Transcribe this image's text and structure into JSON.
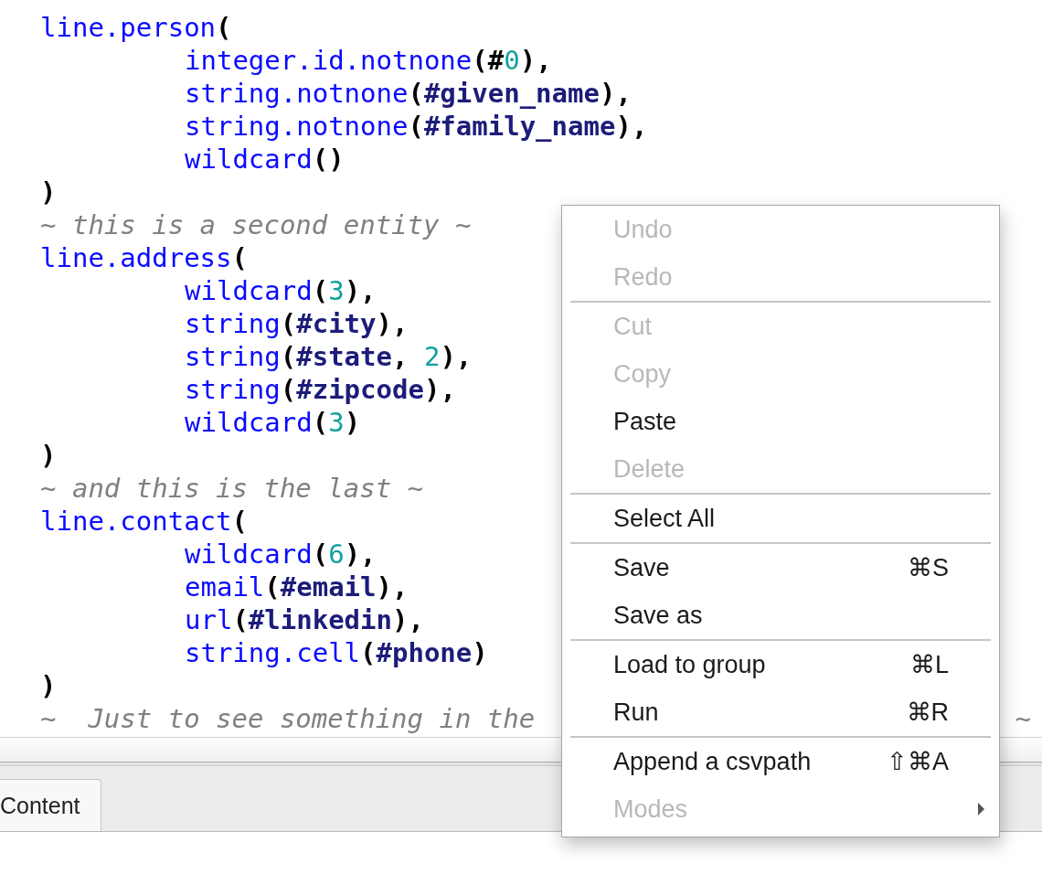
{
  "editor": {
    "lines": [
      {
        "tokens": [
          {
            "kind": "fn",
            "text": "line.person"
          },
          {
            "kind": "punct",
            "text": "("
          }
        ],
        "children": [
          {
            "tokens": [
              {
                "kind": "fn",
                "text": "integer.id.notnone"
              },
              {
                "kind": "punct",
                "text": "(#"
              },
              {
                "kind": "num",
                "text": "0"
              },
              {
                "kind": "punct",
                "text": "),"
              }
            ]
          },
          {
            "tokens": [
              {
                "kind": "fn",
                "text": "string.notnone"
              },
              {
                "kind": "punct",
                "text": "("
              },
              {
                "kind": "arg",
                "text": "#given_name"
              },
              {
                "kind": "punct",
                "text": "),"
              }
            ]
          },
          {
            "tokens": [
              {
                "kind": "fn",
                "text": "string.notnone"
              },
              {
                "kind": "punct",
                "text": "("
              },
              {
                "kind": "arg",
                "text": "#family_name"
              },
              {
                "kind": "punct",
                "text": "),"
              }
            ]
          },
          {
            "tokens": [
              {
                "kind": "fn",
                "text": "wildcard"
              },
              {
                "kind": "punct",
                "text": "()"
              }
            ]
          }
        ]
      },
      {
        "tokens": [
          {
            "kind": "punct",
            "text": ")"
          }
        ]
      },
      {
        "tokens": [
          {
            "kind": "comment",
            "text": "~ this is a second entity ~"
          }
        ]
      },
      {
        "tokens": [
          {
            "kind": "fn",
            "text": "line.address"
          },
          {
            "kind": "punct",
            "text": "("
          }
        ],
        "children": [
          {
            "tokens": [
              {
                "kind": "fn",
                "text": "wildcard"
              },
              {
                "kind": "punct",
                "text": "("
              },
              {
                "kind": "num",
                "text": "3"
              },
              {
                "kind": "punct",
                "text": "),"
              }
            ]
          },
          {
            "tokens": [
              {
                "kind": "fn",
                "text": "string"
              },
              {
                "kind": "punct",
                "text": "("
              },
              {
                "kind": "arg",
                "text": "#city"
              },
              {
                "kind": "punct",
                "text": "),"
              }
            ]
          },
          {
            "tokens": [
              {
                "kind": "fn",
                "text": "string"
              },
              {
                "kind": "punct",
                "text": "("
              },
              {
                "kind": "arg",
                "text": "#state"
              },
              {
                "kind": "punct",
                "text": ", "
              },
              {
                "kind": "num",
                "text": "2"
              },
              {
                "kind": "punct",
                "text": "),"
              }
            ]
          },
          {
            "tokens": [
              {
                "kind": "fn",
                "text": "string"
              },
              {
                "kind": "punct",
                "text": "("
              },
              {
                "kind": "arg",
                "text": "#zipcode"
              },
              {
                "kind": "punct",
                "text": "),"
              }
            ]
          },
          {
            "tokens": [
              {
                "kind": "fn",
                "text": "wildcard"
              },
              {
                "kind": "punct",
                "text": "("
              },
              {
                "kind": "num",
                "text": "3"
              },
              {
                "kind": "punct",
                "text": ")"
              }
            ]
          }
        ]
      },
      {
        "tokens": [
          {
            "kind": "punct",
            "text": ")"
          }
        ]
      },
      {
        "tokens": [
          {
            "kind": "comment",
            "text": "~ and this is the last ~"
          }
        ]
      },
      {
        "tokens": [
          {
            "kind": "fn",
            "text": "line.contact"
          },
          {
            "kind": "punct",
            "text": "("
          }
        ],
        "children": [
          {
            "tokens": [
              {
                "kind": "fn",
                "text": "wildcard"
              },
              {
                "kind": "punct",
                "text": "("
              },
              {
                "kind": "num",
                "text": "6"
              },
              {
                "kind": "punct",
                "text": "),"
              }
            ]
          },
          {
            "tokens": [
              {
                "kind": "fn",
                "text": "email"
              },
              {
                "kind": "punct",
                "text": "("
              },
              {
                "kind": "arg",
                "text": "#email"
              },
              {
                "kind": "punct",
                "text": "),"
              }
            ]
          },
          {
            "tokens": [
              {
                "kind": "fn",
                "text": "url"
              },
              {
                "kind": "punct",
                "text": "("
              },
              {
                "kind": "arg",
                "text": "#linkedin"
              },
              {
                "kind": "punct",
                "text": "),"
              }
            ]
          },
          {
            "tokens": [
              {
                "kind": "fn",
                "text": "string.cell"
              },
              {
                "kind": "punct",
                "text": "("
              },
              {
                "kind": "arg",
                "text": "#phone"
              },
              {
                "kind": "punct",
                "text": ")"
              }
            ]
          }
        ]
      },
      {
        "tokens": [
          {
            "kind": "punct",
            "text": ")"
          }
        ]
      },
      {
        "tokens": [
          {
            "kind": "comment",
            "text": "~  Just to see something in the"
          }
        ],
        "tail": "~"
      }
    ]
  },
  "tabs": [
    {
      "label": "Content",
      "selected": true
    }
  ],
  "context_menu": [
    {
      "kind": "item",
      "label": "Undo",
      "disabled": true
    },
    {
      "kind": "item",
      "label": "Redo",
      "disabled": true
    },
    {
      "kind": "separator"
    },
    {
      "kind": "item",
      "label": "Cut",
      "disabled": true
    },
    {
      "kind": "item",
      "label": "Copy",
      "disabled": true
    },
    {
      "kind": "item",
      "label": "Paste",
      "disabled": false
    },
    {
      "kind": "item",
      "label": "Delete",
      "disabled": true
    },
    {
      "kind": "separator"
    },
    {
      "kind": "item",
      "label": "Select All",
      "disabled": false
    },
    {
      "kind": "separator"
    },
    {
      "kind": "item",
      "label": "Save",
      "shortcut": "⌘S",
      "disabled": false
    },
    {
      "kind": "item",
      "label": "Save as",
      "disabled": false
    },
    {
      "kind": "separator"
    },
    {
      "kind": "item",
      "label": "Load to group",
      "shortcut": "⌘L",
      "disabled": false
    },
    {
      "kind": "item",
      "label": "Run",
      "shortcut": "⌘R",
      "disabled": false
    },
    {
      "kind": "separator"
    },
    {
      "kind": "item",
      "label": "Append a csvpath",
      "shortcut": "⇧⌘A",
      "disabled": false
    },
    {
      "kind": "submenu",
      "label": "Modes",
      "disabled": true
    }
  ]
}
